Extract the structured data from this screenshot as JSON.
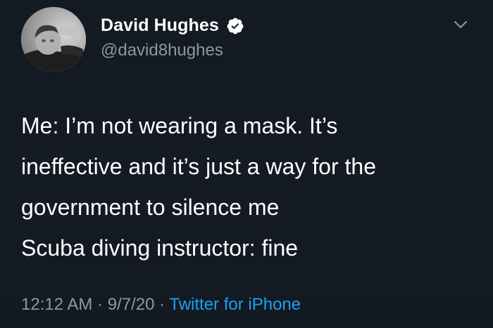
{
  "author": {
    "display_name": "David Hughes",
    "handle": "@david8hughes",
    "verified": true
  },
  "tweet": {
    "lines": [
      "Me: I’m not wearing a mask. It’s",
      "ineffective and it’s just a way for the",
      "government to silence me",
      "Scuba diving instructor: fine"
    ]
  },
  "meta": {
    "time": "12:12 AM",
    "separator": " · ",
    "date": "9/7/20",
    "source": "Twitter for iPhone"
  },
  "icons": {
    "verified": "verified-badge-icon",
    "more": "chevron-down-icon"
  },
  "colors": {
    "background": "#15202b",
    "text": "#ffffff",
    "secondary_text": "#8b98a5",
    "link": "#1da1f2"
  }
}
